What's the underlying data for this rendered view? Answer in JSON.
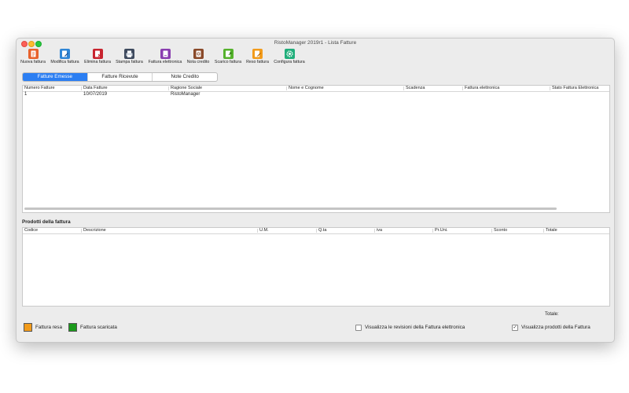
{
  "window": {
    "title": "RistoManager 2019r1 - Lista Fatture"
  },
  "toolbar": [
    {
      "label": "Nuova fattura",
      "icon": "new-invoice-icon",
      "color": "#e8622c"
    },
    {
      "label": "Modifica fattura",
      "icon": "edit-invoice-icon",
      "color": "#2f86d6"
    },
    {
      "label": "Elimina fattura",
      "icon": "delete-invoice-icon",
      "color": "#c8242f"
    },
    {
      "label": "Stampa fattura",
      "icon": "printer-icon",
      "color": "#3e4a5e"
    },
    {
      "label": "Fattura elettronica",
      "icon": "e-invoice-icon",
      "color": "#8a3eb0"
    },
    {
      "label": "Nota credito",
      "icon": "credit-note-icon",
      "color": "#8a4a2a"
    },
    {
      "label": "Scarico fattura",
      "icon": "unload-invoice-icon",
      "color": "#55b22c"
    },
    {
      "label": "Reso fattura",
      "icon": "return-invoice-icon",
      "color": "#f29b1b"
    },
    {
      "label": "Configura fattura",
      "icon": "gear-icon",
      "color": "#1fae7a"
    }
  ],
  "tabs": {
    "emesse": "Fatture Emesse",
    "ricevute": "Fatture Ricevute",
    "note": "Note Credito"
  },
  "invoices": {
    "columns": {
      "numero": "Numero Fatture",
      "data": "Data Fatture",
      "ragione": "Ragione Sociale",
      "nome": "Nome e Cognome",
      "scadenza": "Scadenza",
      "fattura_el": "Fattura elettronica",
      "stato": "Stato Fattura Elettronica"
    },
    "rows": [
      {
        "numero": "1",
        "data": "10/07/2019",
        "ragione": "RistoManager",
        "nome": "",
        "scadenza": "",
        "fattura_el": "",
        "stato": ""
      }
    ]
  },
  "products": {
    "title": "Prodotti della fattura",
    "columns": {
      "codice": "Codice",
      "descrizione": "Descrizione",
      "um": "U.M.",
      "qta": "Q.ta",
      "iva": "iva",
      "pruni": "Pr.Uni.",
      "sconto": "Sconto",
      "totale": "Totale"
    }
  },
  "footer": {
    "totale_label": "Totale:",
    "legend": [
      {
        "label": "Fattura resa",
        "color": "#f29b1b"
      },
      {
        "label": "Fattura scaricata",
        "color": "#1b9a1b"
      }
    ],
    "check_revisioni": {
      "label": "Visualizza le revisioni della Fattura elettronica",
      "checked": false
    },
    "check_prodotti": {
      "label": "Visualizza prodotti della Fattura",
      "checked": true,
      "mark": "✓"
    }
  }
}
